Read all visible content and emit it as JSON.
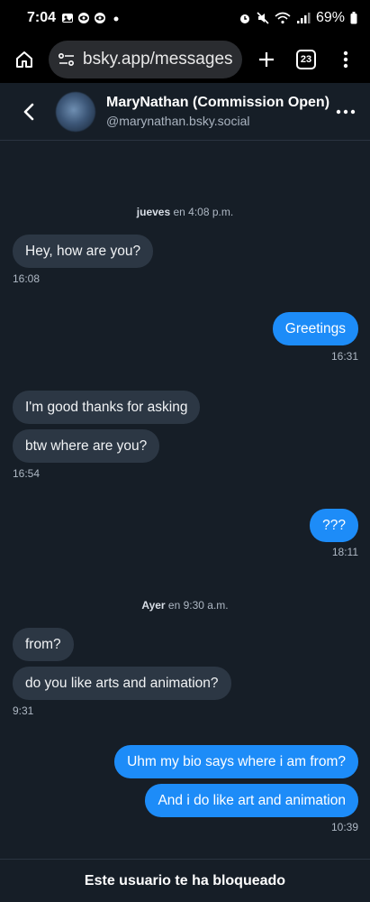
{
  "status": {
    "time": "7:04",
    "battery": "69%",
    "left_icons": [
      "gallery-icon",
      "eye-icon",
      "eye-icon",
      "dot-icon"
    ],
    "right_icons": [
      "alarm-icon",
      "mute-icon",
      "wifi-icon",
      "signal-icon",
      "battery-icon"
    ]
  },
  "browser": {
    "url": "bsky.app/messages",
    "tab_count": "23"
  },
  "conversation": {
    "display_name": "MaryNathan (Commission Open)",
    "handle": "@marynathan.bsky.social"
  },
  "messages": {
    "sep1": {
      "day": "jueves",
      "rest": " en 4:08 p.m."
    },
    "m1": "Hey, how are you?",
    "t1": "16:08",
    "m2": "Greetings",
    "t2": "16:31",
    "m3": "I'm good thanks for asking",
    "m4": "btw where are you?",
    "t3": "16:54",
    "m5": "???",
    "t4": "18:11",
    "sep2": {
      "day": "Ayer",
      "rest": " en 9:30 a.m."
    },
    "m6": "from?",
    "m7": "do you like arts and animation?",
    "t5": "9:31",
    "m8": "Uhm my bio says where i am from?",
    "m9": "And i do like art and animation",
    "t6": "10:39"
  },
  "footer": {
    "text": "Este usuario te ha bloqueado"
  },
  "colors": {
    "background": "#161e27",
    "incoming_bubble": "#2c3744",
    "outgoing_bubble": "#1d8cf8"
  }
}
